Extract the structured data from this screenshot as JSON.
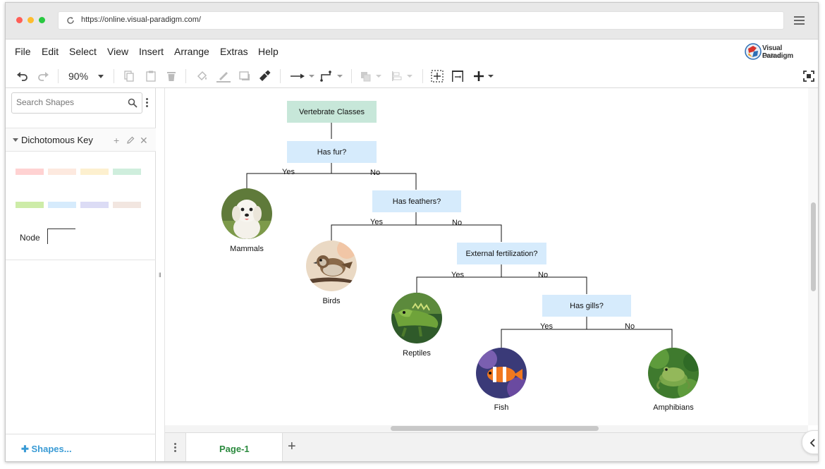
{
  "browser": {
    "url": "https://online.visual-paradigm.com/",
    "dots": [
      "#ff5f57",
      "#febc2e",
      "#28c840"
    ]
  },
  "menu": {
    "items": [
      "File",
      "Edit",
      "Select",
      "View",
      "Insert",
      "Arrange",
      "Extras",
      "Help"
    ],
    "logo_line1": "Visual Paradigm",
    "logo_line2": "Online"
  },
  "toolbar": {
    "zoom": "90%",
    "icons": [
      "undo-icon",
      "redo-icon",
      "zoom-dropdown-icon",
      "copy-icon",
      "paste-icon",
      "delete-icon",
      "fill-color-icon",
      "line-color-icon",
      "shadow-icon",
      "format-painter-icon",
      "connector-icon",
      "waypoint-icon",
      "to-front-icon",
      "align-icon",
      "fit-page-icon",
      "fit-width-icon",
      "insert-plus-icon",
      "fullscreen-icon"
    ]
  },
  "sidebar": {
    "search_placeholder": "Search Shapes",
    "library_title": "Dichotomous Key",
    "swatches_row1": [
      "#ffd2d2",
      "#fde9df",
      "#fdf0cf",
      "#cfeedd"
    ],
    "swatches_row2": [
      "#cdeca8",
      "#d6ebfc",
      "#dcdcf5",
      "#f2e6e0"
    ],
    "node_label": "Node",
    "shapes_button": "Shapes..."
  },
  "diagram": {
    "root": "Vertebrate Classes",
    "questions": [
      "Has fur?",
      "Has feathers?",
      "External fertilization?",
      "Has gills?"
    ],
    "yes_label": "Yes",
    "no_label": "No",
    "classes": [
      "Mammals",
      "Birds",
      "Reptiles",
      "Fish",
      "Amphibians"
    ],
    "root_color": "#c7e7d9",
    "question_color": "#d6ebfc"
  },
  "pages": {
    "active": "Page-1"
  }
}
